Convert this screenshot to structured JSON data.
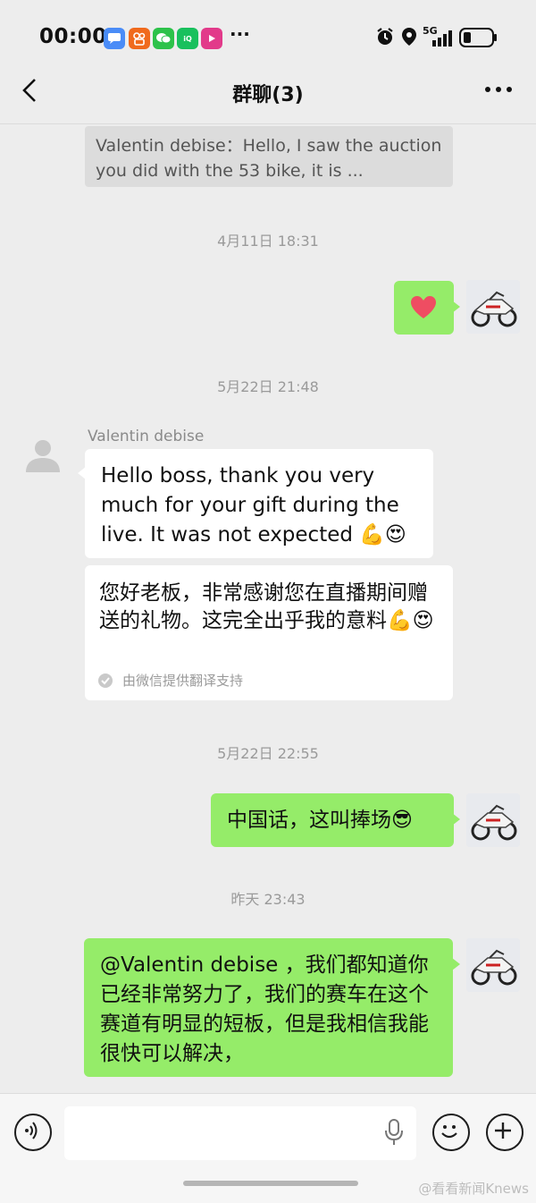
{
  "status_bar": {
    "time": "00:00",
    "network": "5G",
    "more": "···",
    "apps": [
      {
        "name": "messages-app-icon",
        "color": "#4a8cf7",
        "glyph": "💬"
      },
      {
        "name": "kuaishou-app-icon",
        "color": "#f06a1d",
        "glyph": "◉"
      },
      {
        "name": "wechat-app-icon",
        "color": "#2dc24a",
        "glyph": "●"
      },
      {
        "name": "iqiyi-app-icon",
        "color": "#19c05d",
        "glyph": "iQ"
      },
      {
        "name": "video-app-icon",
        "color": "#e23a8a",
        "glyph": "▶"
      }
    ]
  },
  "header": {
    "title": "群聊(3)",
    "back": "‹",
    "more": "···"
  },
  "messages": {
    "quote_text": "Valentin debise：Hello, I saw the auction you did with the 53 bike, it is ...",
    "time1": "4月11日 18:31",
    "heart": "❤",
    "time2": "5月22日 21:48",
    "sender_name": "Valentin debise",
    "msg_en": "Hello boss, thank you very much for your gift during the live. It was not expected 💪😍",
    "msg_cn": "您好老板，非常感谢您在直播期间赠送的礼物。这完全出乎我的意料💪😍",
    "translate_note": "由微信提供翻译支持",
    "time3": "5月22日 22:55",
    "reply1": "中国话，这叫捧场😎",
    "time4": "昨天 23:43",
    "reply2": "@Valentin debise ，我们都知道你已经非常努力了，我们的赛车在这个赛道有明显的短板，但是我相信我能很快可以解决，"
  },
  "input": {
    "placeholder": ""
  },
  "watermark": "@看看新闻Knews",
  "colors": {
    "bg": "#ededed",
    "my_bubble": "#95ec69",
    "their_bubble": "#ffffff"
  }
}
